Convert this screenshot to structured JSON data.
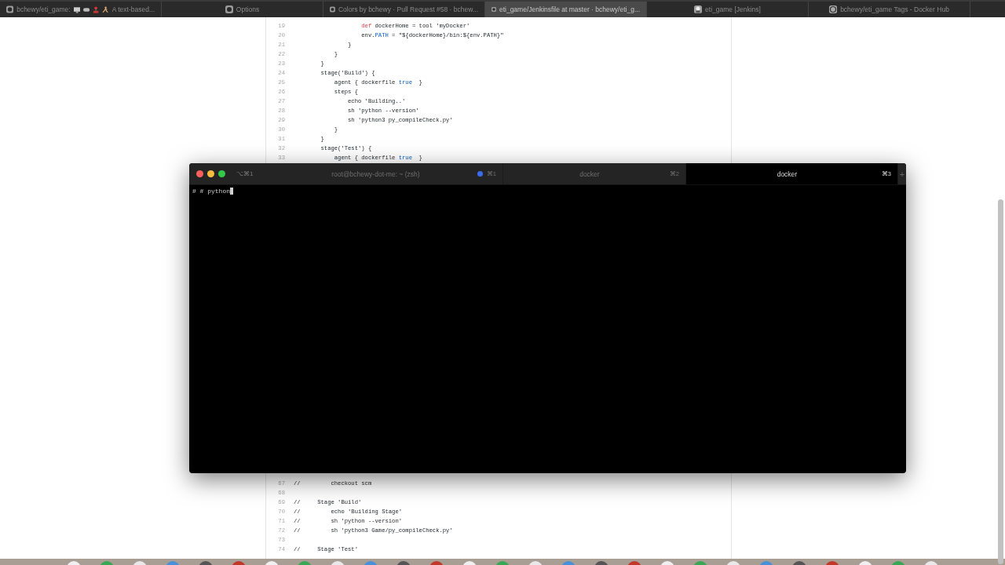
{
  "browser_tabs": [
    {
      "kind": "github",
      "title": "bchewy/eti_game:",
      "title_after_icons": "A text-based...",
      "selected": false
    },
    {
      "kind": "github",
      "title": "Options",
      "selected": false
    },
    {
      "kind": "github",
      "title": "Colors by bchewy · Pull Request #58 · bchew...",
      "selected": false
    },
    {
      "kind": "github",
      "title": "eti_game/Jenkinsfile at master · bchewy/eti_g...",
      "selected": true
    },
    {
      "kind": "jenkins",
      "title": "eti_game [Jenkins]",
      "selected": false
    },
    {
      "kind": "docker",
      "title": "bchewy/eti_game Tags - Docker Hub",
      "selected": false
    }
  ],
  "code_top": [
    {
      "number": "19",
      "tokens": [
        {
          "text": "                    def",
          "kind": "keyword"
        },
        {
          "text": " dockerHome = tool 'myDocker'",
          "kind": "plain"
        }
      ]
    },
    {
      "number": "20",
      "tokens": [
        {
          "text": "                    env.",
          "kind": "plain"
        },
        {
          "text": "PATH",
          "kind": "literal"
        },
        {
          "text": " = \"${dockerHome}/bin:${env.PATH}\"",
          "kind": "plain"
        }
      ]
    },
    {
      "number": "21",
      "tokens": [
        {
          "text": "                }",
          "kind": "plain"
        }
      ]
    },
    {
      "number": "22",
      "tokens": [
        {
          "text": "            }",
          "kind": "plain"
        }
      ]
    },
    {
      "number": "23",
      "tokens": [
        {
          "text": "        }",
          "kind": "plain"
        }
      ]
    },
    {
      "number": "24",
      "tokens": [
        {
          "text": "        stage('Build') {",
          "kind": "plain"
        }
      ]
    },
    {
      "number": "25",
      "tokens": [
        {
          "text": "            agent { dockerfile ",
          "kind": "plain"
        },
        {
          "text": "true",
          "kind": "literal"
        },
        {
          "text": "  }",
          "kind": "plain"
        }
      ]
    },
    {
      "number": "26",
      "tokens": [
        {
          "text": "            steps {",
          "kind": "plain"
        }
      ]
    },
    {
      "number": "27",
      "tokens": [
        {
          "text": "                echo 'Building..'",
          "kind": "plain"
        }
      ]
    },
    {
      "number": "28",
      "tokens": [
        {
          "text": "                sh 'python --version'",
          "kind": "plain"
        }
      ]
    },
    {
      "number": "29",
      "tokens": [
        {
          "text": "                sh 'python3 py_compileCheck.py'",
          "kind": "plain"
        }
      ]
    },
    {
      "number": "30",
      "tokens": [
        {
          "text": "            }",
          "kind": "plain"
        }
      ]
    },
    {
      "number": "31",
      "tokens": [
        {
          "text": "        }",
          "kind": "plain"
        }
      ]
    },
    {
      "number": "32",
      "tokens": [
        {
          "text": "        stage('Test') {",
          "kind": "plain"
        }
      ]
    },
    {
      "number": "33",
      "tokens": [
        {
          "text": "            agent { dockerfile ",
          "kind": "plain"
        },
        {
          "text": "true",
          "kind": "literal"
        },
        {
          "text": "  }",
          "kind": "plain"
        }
      ]
    }
  ],
  "code_bottom": [
    {
      "number": "67",
      "tokens": [
        {
          "text": "//         checkout scm",
          "kind": "plain"
        }
      ]
    },
    {
      "number": "68"
    },
    {
      "number": "69",
      "tokens": [
        {
          "text": "//     Stage 'Build'",
          "kind": "plain"
        }
      ]
    },
    {
      "number": "70",
      "tokens": [
        {
          "text": "//         echo 'Building Stage'",
          "kind": "plain"
        }
      ]
    },
    {
      "number": "71",
      "tokens": [
        {
          "text": "//         sh 'python --version'",
          "kind": "plain"
        }
      ]
    },
    {
      "number": "72",
      "tokens": [
        {
          "text": "//         sh 'python3 Game/py_compileCheck.py'",
          "kind": "plain"
        }
      ]
    },
    {
      "number": "73"
    },
    {
      "number": "74",
      "tokens": [
        {
          "text": "//     Stage 'Test'",
          "kind": "plain"
        }
      ]
    }
  ],
  "terminal": {
    "window_label": "⌥⌘1",
    "tabs": [
      {
        "title": "root@bchewy-dot-me: ~ (zsh)",
        "shortcut": "⌘1",
        "activity": true,
        "selected": false
      },
      {
        "title": "docker",
        "shortcut": "⌘2",
        "activity": false,
        "selected": false
      },
      {
        "title": "docker",
        "shortcut": "⌘3",
        "activity": false,
        "selected": true
      }
    ],
    "new_tab": "+",
    "lines": [
      "# # python"
    ],
    "cursor_visible": true
  }
}
